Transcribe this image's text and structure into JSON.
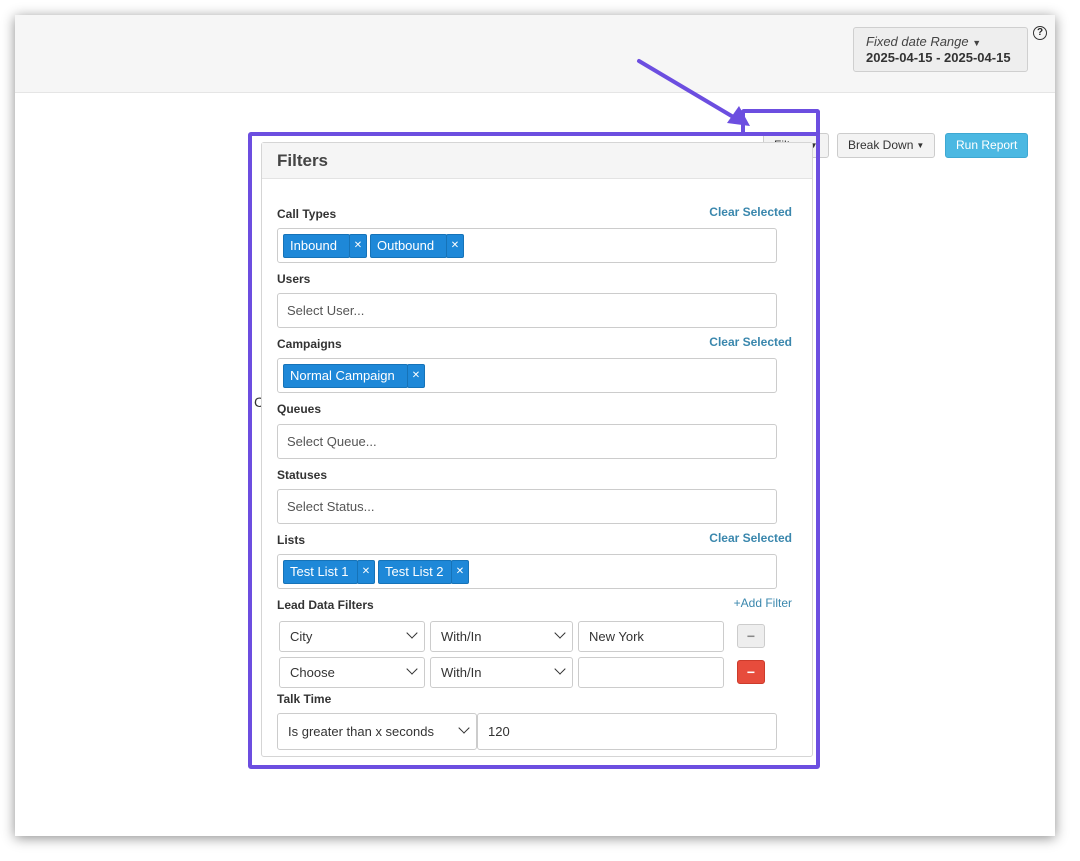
{
  "header": {
    "date_range_label": "Fixed date Range",
    "date_range_value": "2025-04-15 - 2025-04-15",
    "help_glyph": "?"
  },
  "toolbar": {
    "filters_label": "Filters",
    "breakdown_label": "Break Down",
    "run_report_label": "Run Report"
  },
  "background_text": "C",
  "filters": {
    "title": "Filters",
    "call_types": {
      "label": "Call Types",
      "clear_label": "Clear Selected",
      "tags": [
        "Inbound",
        "Outbound"
      ]
    },
    "users": {
      "label": "Users",
      "placeholder": "Select User..."
    },
    "campaigns": {
      "label": "Campaigns",
      "clear_label": "Clear Selected",
      "tags": [
        "Normal Campaign"
      ]
    },
    "queues": {
      "label": "Queues",
      "placeholder": "Select Queue..."
    },
    "statuses": {
      "label": "Statuses",
      "placeholder": "Select Status..."
    },
    "lists": {
      "label": "Lists",
      "clear_label": "Clear Selected",
      "tags": [
        "Test List 1",
        "Test List 2"
      ]
    },
    "lead_data": {
      "label": "Lead Data Filters",
      "add_label": "+Add Filter",
      "rows": [
        {
          "field": "City",
          "operator": "With/In",
          "value": "New York"
        },
        {
          "field": "Choose",
          "operator": "With/In",
          "value": ""
        }
      ]
    },
    "talk_time": {
      "label": "Talk Time",
      "condition": "Is greater than x seconds",
      "value": "120"
    }
  },
  "colors": {
    "highlight": "#6c4ee0",
    "tag": "#1e88d8",
    "link": "#3a87ad",
    "danger": "#e74c3c",
    "primary": "#4bb8e2"
  }
}
